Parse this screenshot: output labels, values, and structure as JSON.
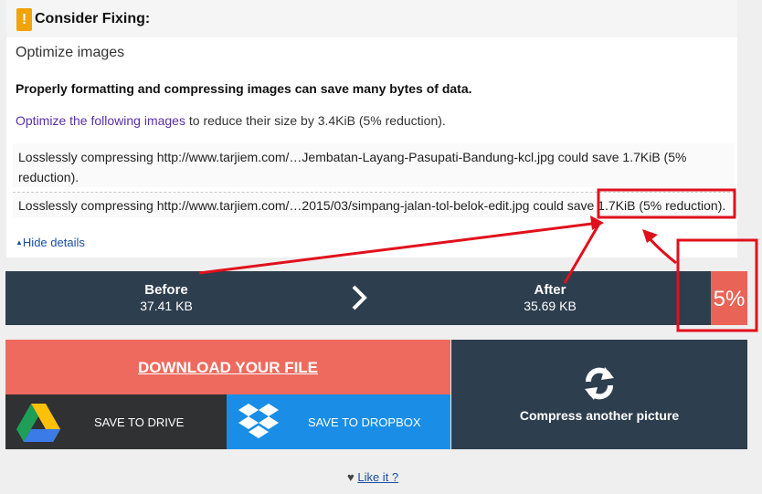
{
  "panel": {
    "warn_glyph": "!",
    "title": "Consider Fixing:",
    "subtitle": "Optimize images",
    "bold_line": "Properly formatting and compressing images can save many bytes of data.",
    "link_text": "Optimize the following images",
    "reduce_rest": " to reduce their size by 3.4KiB (5% reduction).",
    "entries": [
      "Lossless​ly compressing http://www.tarjiem.com/…Jembatan-Layang-Pasupati-Bandung-kcl.jpg could save 1.7KiB (5% reduction).",
      "Losslessly compressing http://www.tarjiem.com/…2015/03/simpang-jalan-tol-belok-edit.jpg could save 1.7KiB (5% reduction)."
    ],
    "hide_details": "Hide details"
  },
  "comparison": {
    "before_label": "Before",
    "before_size": "37.41 KB",
    "after_label": "After",
    "after_size": "35.69 KB",
    "percent": "5%"
  },
  "actions": {
    "download": "DOWNLOAD YOUR FILE",
    "save_drive": "SAVE TO DRIVE",
    "save_dropbox": "SAVE TO DROPBOX",
    "compress_another": "Compress another picture"
  },
  "footer": {
    "like": "Like it ?"
  },
  "colors": {
    "accent_red": "#ee6a5e",
    "dark_bar": "#2d3e4f",
    "dropbox_blue": "#1a8ee6",
    "annotation_red": "#e0101c"
  },
  "icons": [
    "warning-icon",
    "chevron-right-icon",
    "google-drive-icon",
    "dropbox-icon",
    "refresh-icon",
    "heart-icon"
  ]
}
